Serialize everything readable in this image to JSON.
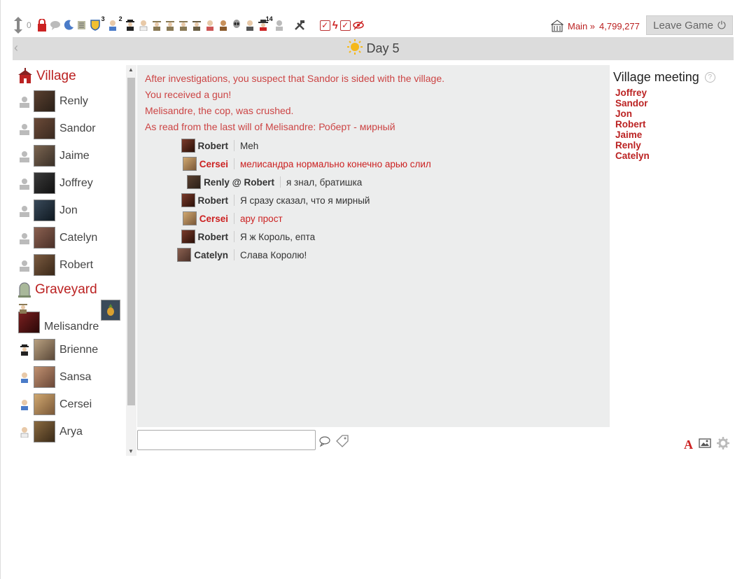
{
  "toolbar": {
    "move_count": "0",
    "badge_a": "3",
    "badge_b": "2",
    "badge_c": "14"
  },
  "header": {
    "main_label": "Main »",
    "points": "4,799,277",
    "leave_label": "Leave Game"
  },
  "day": {
    "title": "Day 5",
    "back": "‹"
  },
  "village": {
    "title": "Village",
    "players": [
      "Renly",
      "Sandor",
      "Jaime",
      "Joffrey",
      "Jon",
      "Catelyn",
      "Robert"
    ]
  },
  "graveyard": {
    "title": "Graveyard",
    "players": [
      "Melisandre",
      "Brienne",
      "Sansa",
      "Cersei",
      "Arya"
    ]
  },
  "log": {
    "system": [
      "After investigations, you suspect that Sandor is sided with the village.",
      "You received a gun!",
      "Melisandre, the cop, was crushed.",
      "As read from the last will of Melisandre: Роберт - мирный"
    ],
    "messages": [
      {
        "who": "Robert",
        "text": "Meh"
      },
      {
        "who": "Cersei",
        "text": "мелисандра нормально конечно арью слил"
      },
      {
        "who": "Renly @ Robert",
        "text": "я знал, братишка"
      },
      {
        "who": "Robert",
        "text": "Я сразу сказал, что я мирный"
      },
      {
        "who": "Cersei",
        "text": "ару прост"
      },
      {
        "who": "Robert",
        "text": "Я ж Король, епта"
      },
      {
        "who": "Catelyn",
        "text": "Слава Королю!"
      }
    ]
  },
  "meeting": {
    "title": "Village meeting",
    "help": "?",
    "votes": [
      "Joffrey",
      "Sandor",
      "Jon",
      "Robert",
      "Jaime",
      "Renly",
      "Catelyn"
    ]
  },
  "chat": {
    "value": "",
    "placeholder": ""
  },
  "format": {
    "font_glyph": "A"
  },
  "colors": {
    "accent": "#bb2222",
    "log_bg": "#eceded"
  }
}
